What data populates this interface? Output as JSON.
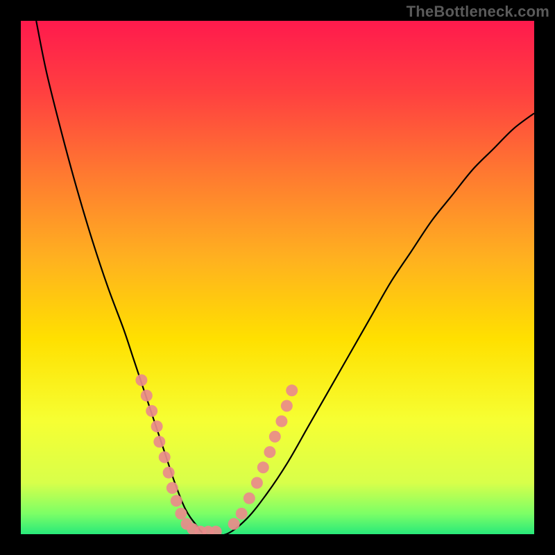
{
  "watermark": "TheBottleneck.com",
  "chart_data": {
    "type": "line",
    "title": "",
    "xlabel": "",
    "ylabel": "",
    "xlim": [
      0,
      100
    ],
    "ylim": [
      0,
      100
    ],
    "grid": false,
    "legend": false,
    "background_gradient": [
      "#ff1a4d",
      "#ff4040",
      "#ff7a30",
      "#ffb020",
      "#ffe000",
      "#f6ff33",
      "#d8ff4a",
      "#7cff66",
      "#28e97a"
    ],
    "series": [
      {
        "name": "bottleneck-curve",
        "color": "#000000",
        "x": [
          3,
          5,
          8,
          11,
          14,
          17,
          20,
          22,
          24,
          26,
          28,
          30,
          32,
          34,
          36,
          40,
          44,
          48,
          52,
          56,
          60,
          64,
          68,
          72,
          76,
          80,
          84,
          88,
          92,
          96,
          100
        ],
        "y": [
          100,
          90,
          78,
          67,
          57,
          48,
          40,
          34,
          28,
          22,
          16,
          10,
          5,
          2,
          0,
          0,
          3,
          8,
          14,
          21,
          28,
          35,
          42,
          49,
          55,
          61,
          66,
          71,
          75,
          79,
          82
        ]
      }
    ],
    "markers": [
      {
        "name": "cluster-left",
        "color": "#e98b8b",
        "points": [
          {
            "x": 23.5,
            "y": 30
          },
          {
            "x": 24.5,
            "y": 27
          },
          {
            "x": 25.5,
            "y": 24
          },
          {
            "x": 26.5,
            "y": 21
          },
          {
            "x": 27.0,
            "y": 18
          },
          {
            "x": 28.0,
            "y": 15
          },
          {
            "x": 28.8,
            "y": 12
          },
          {
            "x": 29.5,
            "y": 9
          },
          {
            "x": 30.3,
            "y": 6.5
          },
          {
            "x": 31.2,
            "y": 4
          },
          {
            "x": 32.3,
            "y": 2
          },
          {
            "x": 33.5,
            "y": 1
          },
          {
            "x": 35.0,
            "y": 0.5
          },
          {
            "x": 36.5,
            "y": 0.5
          },
          {
            "x": 38.0,
            "y": 0.5
          }
        ]
      },
      {
        "name": "cluster-right",
        "color": "#e98b8b",
        "points": [
          {
            "x": 41.5,
            "y": 2
          },
          {
            "x": 43.0,
            "y": 4
          },
          {
            "x": 44.5,
            "y": 7
          },
          {
            "x": 46.0,
            "y": 10
          },
          {
            "x": 47.2,
            "y": 13
          },
          {
            "x": 48.5,
            "y": 16
          },
          {
            "x": 49.5,
            "y": 19
          },
          {
            "x": 50.8,
            "y": 22
          },
          {
            "x": 51.8,
            "y": 25
          },
          {
            "x": 52.8,
            "y": 28
          }
        ]
      }
    ]
  }
}
